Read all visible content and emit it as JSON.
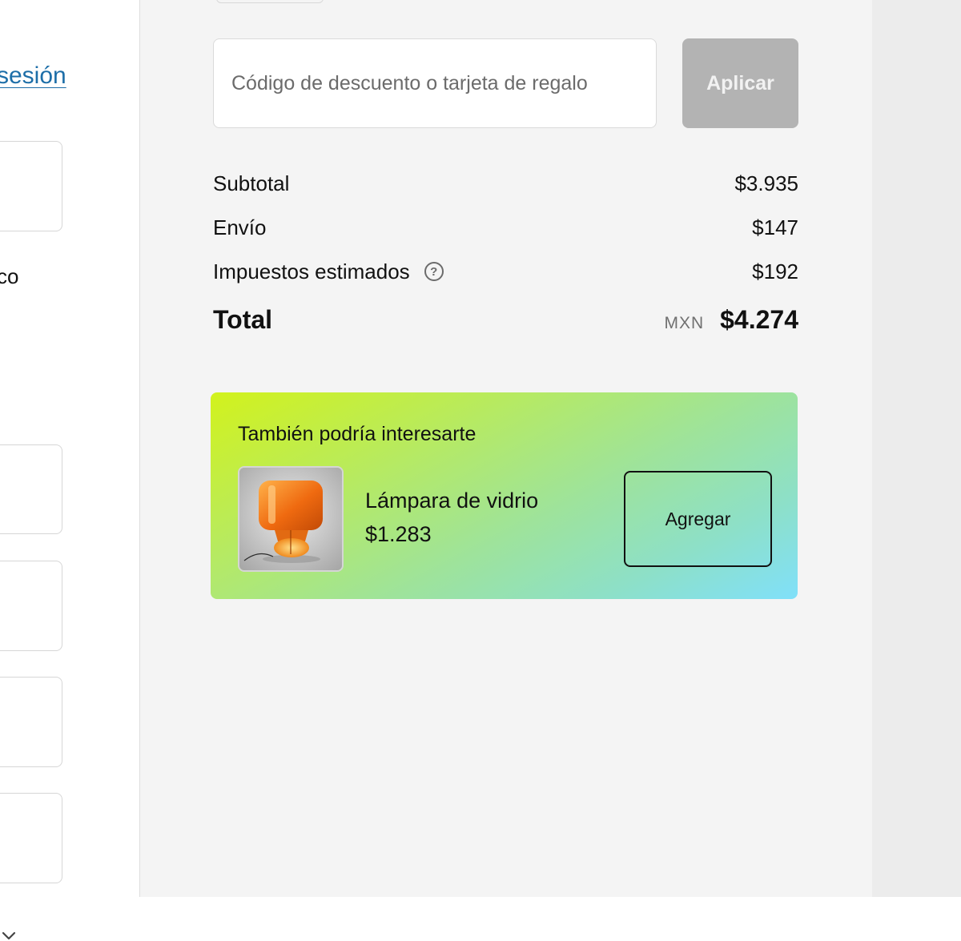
{
  "left_panel": {
    "login_link": "sesión",
    "partial_text": "co",
    "chevron_icon": "chevron-down-icon"
  },
  "discount": {
    "placeholder": "Código de descuento o tarjeta de regalo",
    "apply_label": "Aplicar"
  },
  "summary": {
    "rows": [
      {
        "label": "Subtotal",
        "value": "$3.935"
      },
      {
        "label": "Envío",
        "value": "$147"
      },
      {
        "label": "Impuestos estimados",
        "value": "$192",
        "icon": "help-icon",
        "icon_glyph": "?"
      }
    ],
    "total": {
      "label": "Total",
      "currency": "MXN",
      "value": "$4.274"
    }
  },
  "upsell": {
    "title": "También podría interesarte",
    "product": {
      "name": "Lámpara de vidrio",
      "price": "$1.283",
      "image_icon": "lamp-product-image"
    },
    "add_label": "Agregar"
  },
  "colors": {
    "link": "#1d6ea8",
    "apply_disabled": "#b3b3b3",
    "summary_bg": "#f4f4f4",
    "gradient_start": "#d2f21c",
    "gradient_end": "#80e0fa"
  }
}
